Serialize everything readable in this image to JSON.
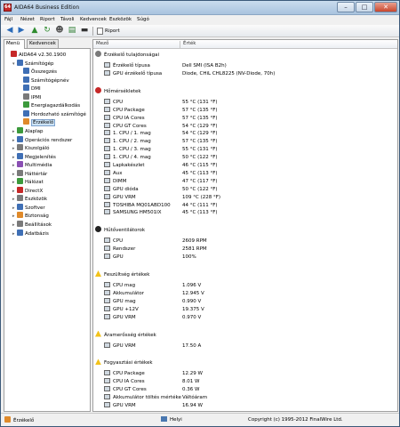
{
  "window": {
    "title": "AIDA64 Business Edition",
    "minimize": "–",
    "maximize": "□",
    "close": "✕"
  },
  "menubar": [
    "Fájl",
    "Nézet",
    "Riport",
    "Távoli",
    "Kedvencek",
    "Eszközök",
    "Súgó"
  ],
  "toolbar": {
    "report_label": "Riport"
  },
  "left": {
    "tabs": [
      "Menü",
      "Kedvencek"
    ],
    "tree": [
      {
        "label": "AIDA64 v2.30.1900",
        "icon": "red",
        "indent": 0,
        "exp": ""
      },
      {
        "label": "Számítógép",
        "icon": "blue",
        "indent": 1,
        "exp": "▾"
      },
      {
        "label": "Összegzés",
        "icon": "blue",
        "indent": 2,
        "exp": ""
      },
      {
        "label": "Számítógépnév",
        "icon": "blue",
        "indent": 2,
        "exp": ""
      },
      {
        "label": "DMI",
        "icon": "blue",
        "indent": 2,
        "exp": ""
      },
      {
        "label": "IPMI",
        "icon": "gray",
        "indent": 2,
        "exp": ""
      },
      {
        "label": "Energiagazdálkodás",
        "icon": "green",
        "indent": 2,
        "exp": ""
      },
      {
        "label": "Hordozható számítógé",
        "icon": "blue",
        "indent": 2,
        "exp": ""
      },
      {
        "label": "Érzékelő",
        "icon": "orange",
        "indent": 2,
        "exp": "",
        "selected": true
      },
      {
        "label": "Alaplap",
        "icon": "green",
        "indent": 1,
        "exp": "▸"
      },
      {
        "label": "Operációs rendszer",
        "icon": "blue",
        "indent": 1,
        "exp": "▸"
      },
      {
        "label": "Kiszolgáló",
        "icon": "gray",
        "indent": 1,
        "exp": "▸"
      },
      {
        "label": "Megjelenítés",
        "icon": "blue",
        "indent": 1,
        "exp": "▸"
      },
      {
        "label": "Multimédia",
        "icon": "purple",
        "indent": 1,
        "exp": "▸"
      },
      {
        "label": "Háttértár",
        "icon": "gray",
        "indent": 1,
        "exp": "▸"
      },
      {
        "label": "Hálózat",
        "icon": "green",
        "indent": 1,
        "exp": "▸"
      },
      {
        "label": "DirectX",
        "icon": "red",
        "indent": 1,
        "exp": "▸"
      },
      {
        "label": "Eszközök",
        "icon": "gray",
        "indent": 1,
        "exp": "▸"
      },
      {
        "label": "Szoftver",
        "icon": "blue",
        "indent": 1,
        "exp": "▸"
      },
      {
        "label": "Biztonság",
        "icon": "orange",
        "indent": 1,
        "exp": "▸"
      },
      {
        "label": "Beállítások",
        "icon": "gray",
        "indent": 1,
        "exp": "▸"
      },
      {
        "label": "Adatbázis",
        "icon": "blue",
        "indent": 1,
        "exp": "▸"
      }
    ]
  },
  "columns": {
    "field": "Mező",
    "value": "Érték"
  },
  "sections": [
    {
      "title": "Érzékelő tulajdonságai",
      "icon": "gray",
      "rows": [
        {
          "label": "Érzékelő típusa",
          "value": "Dell SMI  (ISA B2h)"
        },
        {
          "label": "GPU érzékelő típusa",
          "value": "Diode, CHiL CHL8225  (NV-Diode, 70h)"
        }
      ]
    },
    {
      "title": "Hőmérsékletek",
      "icon": "red",
      "rows": [
        {
          "label": "CPU",
          "value": "55 °C  (131 °F)"
        },
        {
          "label": "CPU Package",
          "value": "57 °C  (135 °F)"
        },
        {
          "label": "CPU IA Cores",
          "value": "57 °C  (135 °F)"
        },
        {
          "label": "CPU GT Cores",
          "value": "54 °C  (129 °F)"
        },
        {
          "label": "1. CPU / 1. mag",
          "value": "54 °C  (129 °F)"
        },
        {
          "label": "1. CPU / 2. mag",
          "value": "57 °C  (135 °F)"
        },
        {
          "label": "1. CPU / 3. mag",
          "value": "55 °C  (131 °F)"
        },
        {
          "label": "1. CPU / 4. mag",
          "value": "50 °C  (122 °F)"
        },
        {
          "label": "Lapkakészlet",
          "value": "46 °C  (115 °F)"
        },
        {
          "label": "Aux",
          "value": "45 °C  (113 °F)"
        },
        {
          "label": "DIMM",
          "value": "47 °C  (117 °F)"
        },
        {
          "label": "GPU dióda",
          "value": "50 °C  (122 °F)"
        },
        {
          "label": "GPU VRM",
          "value": "109 °C  (228 °F)"
        },
        {
          "label": "TOSHIBA MQ01ABD100",
          "value": "44 °C  (111 °F)"
        },
        {
          "label": "SAMSUNG HM501IX",
          "value": "45 °C  (113 °F)"
        }
      ]
    },
    {
      "title": "Hűtőventilátorok",
      "icon": "black",
      "rows": [
        {
          "label": "CPU",
          "value": "2609 RPM"
        },
        {
          "label": "Rendszer",
          "value": "2581 RPM"
        },
        {
          "label": "GPU",
          "value": "100%"
        }
      ]
    },
    {
      "title": "Feszültség értékek",
      "icon": "yellow",
      "rows": [
        {
          "label": "CPU mag",
          "value": "1.096 V"
        },
        {
          "label": "Akkumulátor",
          "value": "12.945 V"
        },
        {
          "label": "GPU mag",
          "value": "0.990 V"
        },
        {
          "label": "GPU +12V",
          "value": "19.375 V"
        },
        {
          "label": "GPU VRM",
          "value": "0.970 V"
        }
      ]
    },
    {
      "title": "Áramerősség értékek",
      "icon": "yellow",
      "rows": [
        {
          "label": "GPU VRM",
          "value": "17.50 A"
        }
      ]
    },
    {
      "title": "Fogyasztási értékek",
      "icon": "yellow",
      "rows": [
        {
          "label": "CPU Package",
          "value": "12.29 W"
        },
        {
          "label": "CPU IA Cores",
          "value": "8.01 W"
        },
        {
          "label": "CPU GT Cores",
          "value": "0.36 W"
        },
        {
          "label": "Akkumulátor töltés mértéke",
          "value": "Váltóáram"
        },
        {
          "label": "GPU VRM",
          "value": "16.94 W"
        }
      ]
    }
  ],
  "status": {
    "left": "Érzékelő",
    "middle": "Helyi",
    "right": "Copyright (c) 1995-2012 FinalWire Ltd."
  }
}
